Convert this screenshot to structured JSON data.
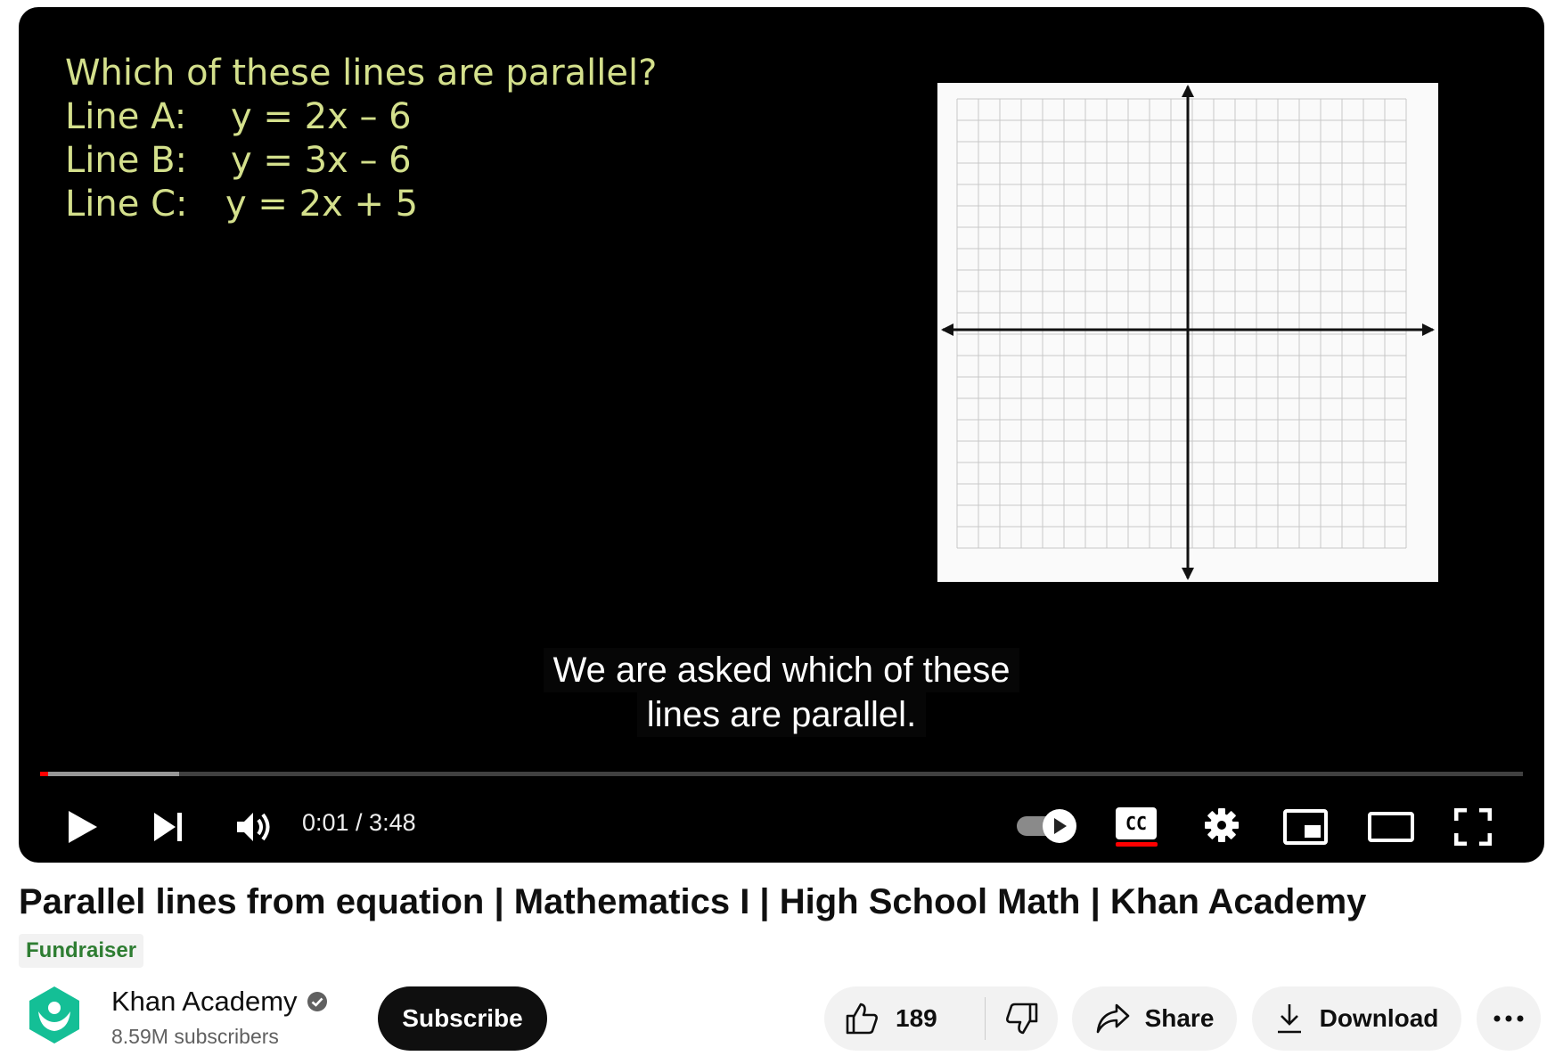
{
  "player": {
    "slide": {
      "question": "Which of these lines are parallel?",
      "lines": [
        {
          "label": "Line A:",
          "equation": "y = 2x – 6"
        },
        {
          "label": "Line B:",
          "equation": "y = 3x – 6"
        },
        {
          "label": "Line C:",
          "equation": "y = 2x + 5"
        }
      ]
    },
    "caption": {
      "line1": "We are asked which of these",
      "line2": "lines are parallel."
    },
    "progress": {
      "played_fraction": 0.004,
      "buffered_fraction": 0.094
    },
    "time_display": "0:01 / 3:48",
    "controls": [
      "play-icon",
      "next-icon",
      "volume-icon",
      "autoplay-toggle",
      "cc-icon",
      "settings-icon",
      "miniplayer-icon",
      "theater-icon",
      "fullscreen-icon"
    ],
    "colors": {
      "slide_text": "#d4e08c",
      "progress_played": "#ff0000"
    }
  },
  "video": {
    "title": "Parallel lines from equation | Mathematics I | High School Math | Khan Academy",
    "badge": "Fundraiser"
  },
  "channel": {
    "name": "Khan Academy",
    "subscribers": "8.59M subscribers",
    "subscribe_label": "Subscribe",
    "colors": {
      "logo": "#14bf96"
    }
  },
  "actions": {
    "like_count": "189",
    "share_label": "Share",
    "download_label": "Download"
  }
}
